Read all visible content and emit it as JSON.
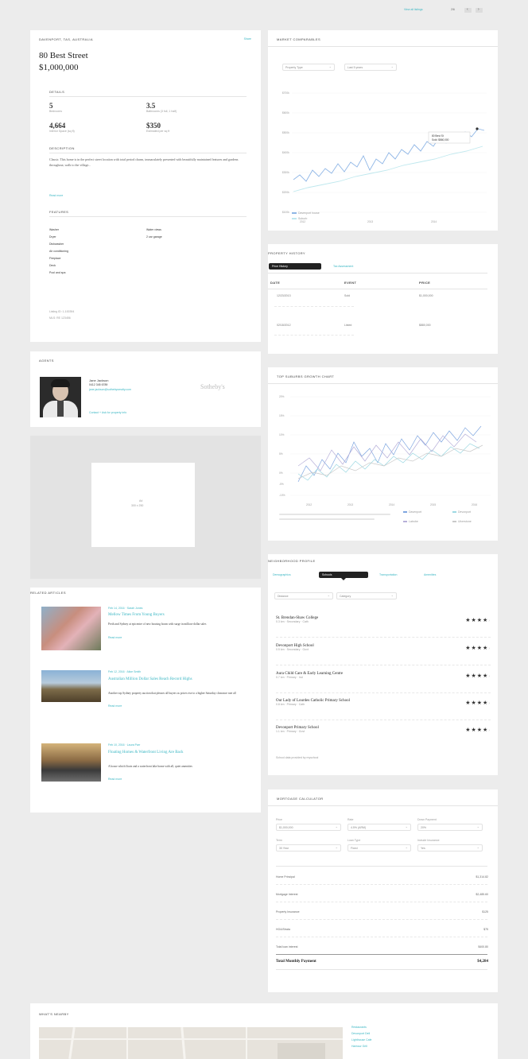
{
  "topbar": {
    "link": "View all listings",
    "page": "2/6",
    "prev": "‹",
    "next": "›"
  },
  "property": {
    "breadcrumb": "Davenport, TAS, Australia",
    "share": "Share",
    "title": "80 Best Street",
    "price": "$1,000,000",
    "details_title": "Details",
    "facts": [
      {
        "value": "5",
        "label": "Bedrooms"
      },
      {
        "value": "3.5",
        "label": "Bathrooms (3 full, 1 half)"
      },
      {
        "value": "4,664",
        "label": "Interior Space (sq ft)"
      },
      {
        "value": "$350",
        "label": "Estimated per sq ft"
      }
    ],
    "desc_title": "Description",
    "desc": "Classic. This home is in the perfect street location with total period charm, immaculately presented with beautifully maintained features and gardens throughout, walk to the village...",
    "read_more": "Read more",
    "features_title": "Features",
    "features_left": [
      "Washer",
      "Dryer",
      "Dishwasher",
      "Air conditioning",
      "Fireplace",
      "Deck",
      "Pool and spa"
    ],
    "features_right": [
      "Water views",
      "2 car garage"
    ],
    "meta": [
      "Listing ID: 1-100394",
      "MLS: RE 123456"
    ]
  },
  "agent": {
    "section": "Agents",
    "name": "Jane Jackson",
    "phone": "0412 345 6789",
    "email": "jane.jackson@sothebysrealty.com",
    "link": "Contact + Ask for property info",
    "brand": "Sotheby's"
  },
  "ad": {
    "label": "Ad",
    "size": "300 x 250"
  },
  "articles": {
    "section": "Related Articles",
    "items": [
      {
        "meta": "Feb 14, 2016 · Sarah Jones",
        "title": "Mellow Times From Young Buyers",
        "body": "Perth and Sydney at epicentre of new housing boom with surge in million-dollar sales",
        "more": "Read more"
      },
      {
        "meta": "Feb 12, 2016 · Alice Smith",
        "title": "Australian Million Dollar Sales Reach Record Highs",
        "body": "Another top Sydney property auction that pleases all buyers as prices rise to a higher Saturday clearance rate all",
        "more": "Read more"
      },
      {
        "meta": "Feb 10, 2016 · Laura Parr",
        "title": "Floating Homes & Waterfront Living Are Back",
        "body": "A house which floats and a waterfront lake home with all, quiet amenities",
        "more": "Read more"
      }
    ]
  },
  "market": {
    "section": "Market Comparables",
    "select1": "Property Type",
    "select2": "Last 5 years",
    "y_ticks": [
      "$700k",
      "$600k",
      "$500k",
      "$400k",
      "$300k",
      "$200k",
      "$100k"
    ],
    "x_ticks": [
      "2012",
      "2013",
      "2014"
    ],
    "legend": [
      "Davenport house",
      "Suburb"
    ],
    "callout": [
      "80 Best St",
      "Sold: $860,000"
    ]
  },
  "history": {
    "section": "Property History",
    "tabs": [
      "Price History",
      "Tax Assessment"
    ],
    "columns": [
      "Date",
      "Event",
      "Price"
    ],
    "rows": [
      {
        "date": "12/23/2013",
        "event": "Sold",
        "price": "$1,000,000"
      },
      {
        "date": "02/18/2012",
        "event": "Listed",
        "price": "$880,000"
      }
    ]
  },
  "growth": {
    "section": "Top Suburbs Growth Chart",
    "y_ticks": [
      "20%",
      "15%",
      "10%",
      "5%",
      "0%",
      "-5%",
      "-10%"
    ],
    "x_ticks": [
      "2012",
      "2013",
      "2014",
      "2015",
      "2016"
    ],
    "legend": [
      "Davenport",
      "Devonport",
      "Latrobe",
      "Ulverstone"
    ]
  },
  "neighborhood": {
    "section": "Neighborhood Profile",
    "tabs": [
      "Demographics",
      "Schools",
      "Transportation",
      "Amenities"
    ],
    "select1": "Distance",
    "select2": "Category",
    "schools": [
      {
        "name": "St. Brendan-Shaw College",
        "sub": "0.3 km · Secondary · Cath"
      },
      {
        "name": "Devonport High School",
        "sub": "0.5 km · Secondary · Govt"
      },
      {
        "name": "Aura Child Care & Early Learning Centre",
        "sub": "0.7 km · Primary · Ind"
      },
      {
        "name": "Our Lady of Lourdes Catholic Primary School",
        "sub": "0.8 km · Primary · Cath"
      },
      {
        "name": "Devonport Primary School",
        "sub": "1.1 km · Primary · Govt"
      }
    ],
    "footnote": "School data provided by myschool"
  },
  "mortgage": {
    "section": "Mortgage Calculator",
    "fields": [
      {
        "label": "Price",
        "value": "$1,000,000"
      },
      {
        "label": "Rate",
        "value": "4.5% (ARM)"
      },
      {
        "label": "Down Payment",
        "value": "20%"
      },
      {
        "label": "Term",
        "value": "30 Year"
      },
      {
        "label": "Loan Type",
        "value": "Fixed"
      },
      {
        "label": "Include Insurance",
        "value": "Yes"
      }
    ],
    "rows": [
      {
        "label": "Home Principal",
        "value": "$1,314.82"
      },
      {
        "label": "Mortgage Interest",
        "value": "$2,485.60"
      },
      {
        "label": "Property Insurance",
        "value": "$125"
      },
      {
        "label": "HOA/Strata",
        "value": "$75"
      },
      {
        "label": "Total loan interest",
        "value": "$400.80"
      }
    ],
    "total_label": "Total Monthly Payment",
    "total_value": "$4,284"
  },
  "whats_nearby": {
    "section": "What's Nearby",
    "list_title": "Restaurants",
    "items": [
      "Devonport Deli",
      "Lighthouse Cafe",
      "Harbour Grill"
    ]
  }
}
